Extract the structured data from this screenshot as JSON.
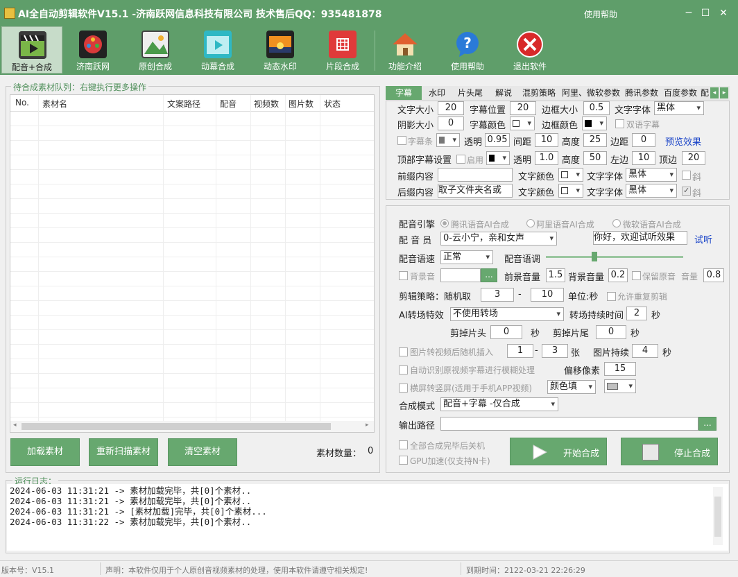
{
  "titlebar": {
    "title": "AI全自动剪辑软件V15.1 -济南跃网信息科技有限公司 技术售后QQ：935481878",
    "help": "使用帮助",
    "min_icon": "minimize-icon",
    "max_icon": "maximize-icon",
    "close_icon": "close-icon"
  },
  "toolbar": {
    "items": [
      {
        "label": "配音+合成",
        "icon": "clapperboard-icon"
      },
      {
        "label": "济南跃网",
        "icon": "film-reel-icon"
      },
      {
        "label": "原创合成",
        "icon": "image-icon"
      },
      {
        "label": "动幕合成",
        "icon": "video-play-icon"
      },
      {
        "label": "动态水印",
        "icon": "sunset-icon"
      },
      {
        "label": "片段合成",
        "icon": "film-strip-icon"
      },
      {
        "label": "功能介绍",
        "icon": "house-icon"
      },
      {
        "label": "使用帮助",
        "icon": "question-icon"
      },
      {
        "label": "退出软件",
        "icon": "exit-icon"
      }
    ]
  },
  "queue": {
    "legend": "待合成素材队列：右键执行更多操作",
    "columns": [
      "No.",
      "素材名",
      "文案路径",
      "配音",
      "视频数",
      "图片数",
      "状态"
    ],
    "load": "加载素材",
    "rescan": "重新扫描素材",
    "clear": "清空素材",
    "count_label": "素材数量：",
    "count": "0"
  },
  "tabs": [
    "字幕",
    "水印",
    "片头尾",
    "解说",
    "混剪策略",
    "阿里、微软参数",
    "腾讯参数",
    "百度参数",
    "配"
  ],
  "subtitle": {
    "font_size_label": "文字大小",
    "font_size": "20",
    "position_label": "字幕位置",
    "position": "20",
    "border_size_label": "边框大小",
    "border_size": "0.5",
    "font_label": "文字字体",
    "font": "黑体",
    "shadow_label": "阴影大小",
    "shadow": "0",
    "color_label": "字幕颜色",
    "border_color_label": "边框颜色",
    "double_label": "双语字幕",
    "bar_label": "字幕条",
    "alpha_label": "透明",
    "alpha": "0.95",
    "spacing_label": "间距",
    "spacing": "10",
    "height_label": "高度",
    "height": "25",
    "margin_label": "边距",
    "margin": "0",
    "preview": "预览效果",
    "top_label": "顶部字幕设置",
    "enable_label": "启用",
    "top_alpha": "1.0",
    "top_height": "50",
    "left_label": "左边",
    "left": "10",
    "topm_label": "顶边",
    "topm": "20",
    "prefix_label": "前缀内容",
    "prefix": "",
    "text_color_label": "文字颜色",
    "prefix_font": "黑体",
    "italic_label": "斜",
    "suffix_label": "后缀内容",
    "suffix": "取子文件夹名或",
    "suffix_font": "黑体"
  },
  "voice": {
    "engine_label": "配音引擎",
    "engines": [
      "腾讯语音AI合成",
      "阿里语音AI合成",
      "微软语音AI合成"
    ],
    "speaker_label": "配 音 员",
    "speaker": "0-云小宁，亲和女声",
    "test_text": "你好，欢迎试听效果",
    "test_btn": "试听",
    "speed_label": "配音语速",
    "speed": "正常",
    "tone_label": "配音语调",
    "bgm_label": "背景音",
    "browse": "...",
    "front_vol_label": "前景音量",
    "front_vol": "1.5",
    "back_vol_label": "背景音量",
    "back_vol": "0.2",
    "keep_label": "保留原音",
    "vol_label": "音量",
    "vol": "0.8",
    "strategy_label": "剪辑策略：随机取",
    "strategy_min": "3",
    "strategy_dash": "-",
    "strategy_max": "10",
    "unit_label": "单位:秒",
    "allow_repeat": "允许重复剪辑",
    "transition_label": "AI转场特效",
    "transition": "不使用转场",
    "trans_dur_label": "转场持续时间",
    "trans_dur": "2",
    "sec": "秒",
    "cut_head_label": "剪掉片头",
    "cut_head": "0",
    "cut_tail_label": "剪掉片尾",
    "cut_tail": "0",
    "img_insert_label": "图片转视频后随机插入",
    "img_min": "1",
    "img_max": "3",
    "zhang": "张",
    "img_dur_label": "图片持续",
    "img_dur": "4",
    "blur_label": "自动识别原视频字幕进行模糊处理",
    "offset_label": "偏移像素",
    "offset": "15",
    "portrait_label": "横屏转竖屏(适用于手机APP视频)",
    "fill": "颜色填",
    "mode_label": "合成模式",
    "mode": "配音+字幕 -仅合成",
    "output_label": "输出路径",
    "output": "",
    "shutdown_label": "全部合成完毕后关机",
    "gpu_label": "GPU加速(仅支持N卡)",
    "start": "开始合成",
    "stop": "停止合成"
  },
  "log": {
    "legend": "运行日志：",
    "lines": [
      "2024-06-03 11:31:21 -> 素材加载完毕，共[0]个素材..",
      "2024-06-03 11:31:21 -> 素材加载完毕，共[0]个素材..",
      "2024-06-03 11:31:21 -> [素材加载]完毕，共[0]个素材...",
      "2024-06-03 11:31:22 -> 素材加载完毕，共[0]个素材.."
    ]
  },
  "status": {
    "version": "版本号：V15.1",
    "notice": "声明：本软件仅用于个人原创音视频素材的处理，使用本软件请遵守相关规定!",
    "expire": "到期时间：2122-03-21 22:26:29"
  },
  "colors": {
    "brand": "#5f9e6a",
    "button": "#67a86f",
    "link": "#1a44c8"
  }
}
